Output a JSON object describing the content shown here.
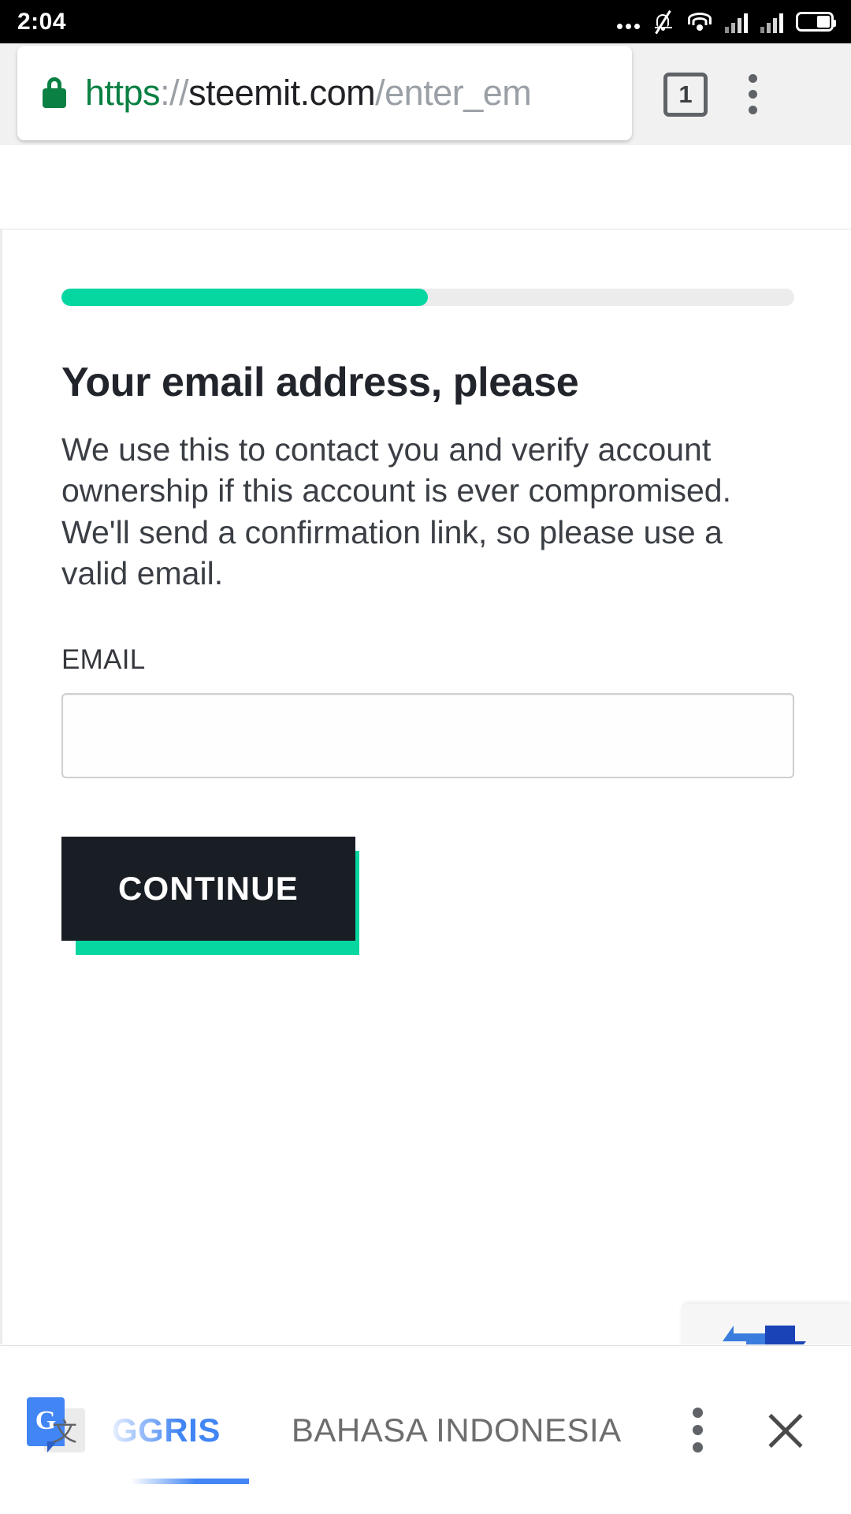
{
  "status_bar": {
    "time": "2:04",
    "icons": [
      "more-dots-icon",
      "notifications-muted-icon",
      "wifi-icon",
      "signal-icon-sim1",
      "signal-icon-sim2",
      "battery-icon"
    ]
  },
  "browser": {
    "url": {
      "scheme": "https",
      "separator": "://",
      "host": "steemit.com",
      "path": "/enter_em"
    },
    "full_url": "https://steemit.com/enter_em",
    "tab_count": "1",
    "menu_label": "more-options",
    "secure_icon": "lock-icon",
    "colors": {
      "scheme_green": "#0a8043",
      "host_black": "#202124",
      "path_gray": "#9aa0a6",
      "chrome_bg": "#f1f1f1"
    }
  },
  "page": {
    "progress": {
      "percent": 50,
      "fill_color": "#06d6a0",
      "track_color": "#ececec"
    },
    "headline": "Your email address, please",
    "body": "We use this to contact you and verify account ownership if this account is ever compromised. We'll send a confirmation link, so please use a valid email.",
    "form": {
      "email_label": "EMAIL",
      "email_value": "",
      "email_placeholder": ""
    },
    "continue_button": {
      "label": "CONTINUE",
      "bg_color": "#191d24",
      "text_color": "#ffffff",
      "shadow_color": "#06d6a0"
    }
  },
  "translate_bar": {
    "logo": "google-translate-icon",
    "source_language": "GGRIS",
    "target_language": "BAHASA INDONESIA",
    "menu_label": "translate-options",
    "close_label": "close-translate-bar",
    "accent_color": "#4285f4",
    "target_color": "#6d6d6d"
  }
}
